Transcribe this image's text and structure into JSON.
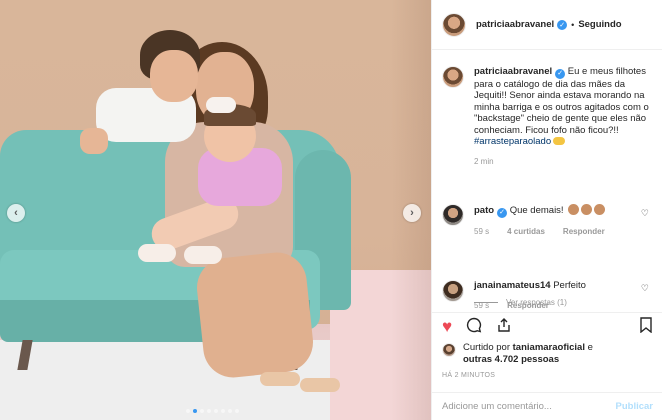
{
  "post": {
    "username": "patriciaabravanel",
    "follow_status": "Seguindo",
    "separator": "•",
    "verified_glyph": "✓",
    "caption_text": "Eu e meus filhotes para o catálogo de dia das mães da Jequiti!! Senor ainda estava morando na minha barriga e os outros agitados com o \"backstage\" cheio de gente que eles não conheciam. Ficou fofo não ficou?!!",
    "hashtag": "#arrasteparaolado",
    "caption_time": "2 min"
  },
  "carousel": {
    "prev_glyph": "‹",
    "next_glyph": "›",
    "dot_count": 8,
    "active_index": 1
  },
  "comments": [
    {
      "username": "pato",
      "text": "Que demais!",
      "time": "59 s",
      "likes": "4 curtidas",
      "reply": "Responder",
      "view_replies": "Ver respostas (1)"
    },
    {
      "username": "janainamateus14",
      "text": "Perfeito",
      "time": "59 s",
      "reply": "Responder"
    }
  ],
  "likes": {
    "liked_by_prefix": "Curtido por",
    "liked_by_user": "taniamaraoficial",
    "and_word": "e",
    "others": "outras 4.702 pessoas"
  },
  "timestamp": "HÁ 2 MINUTOS",
  "comment_box": {
    "placeholder": "Adicione um comentário...",
    "publish_label": "Publicar"
  },
  "icons": {
    "like": "heart-icon",
    "comment": "comment-icon",
    "share": "share-icon",
    "save": "bookmark-icon"
  },
  "colors": {
    "accent": "#3897f0",
    "like_red": "#ed4956",
    "publish_disabled": "#b2dffc",
    "sofa": "#74c0b7"
  }
}
